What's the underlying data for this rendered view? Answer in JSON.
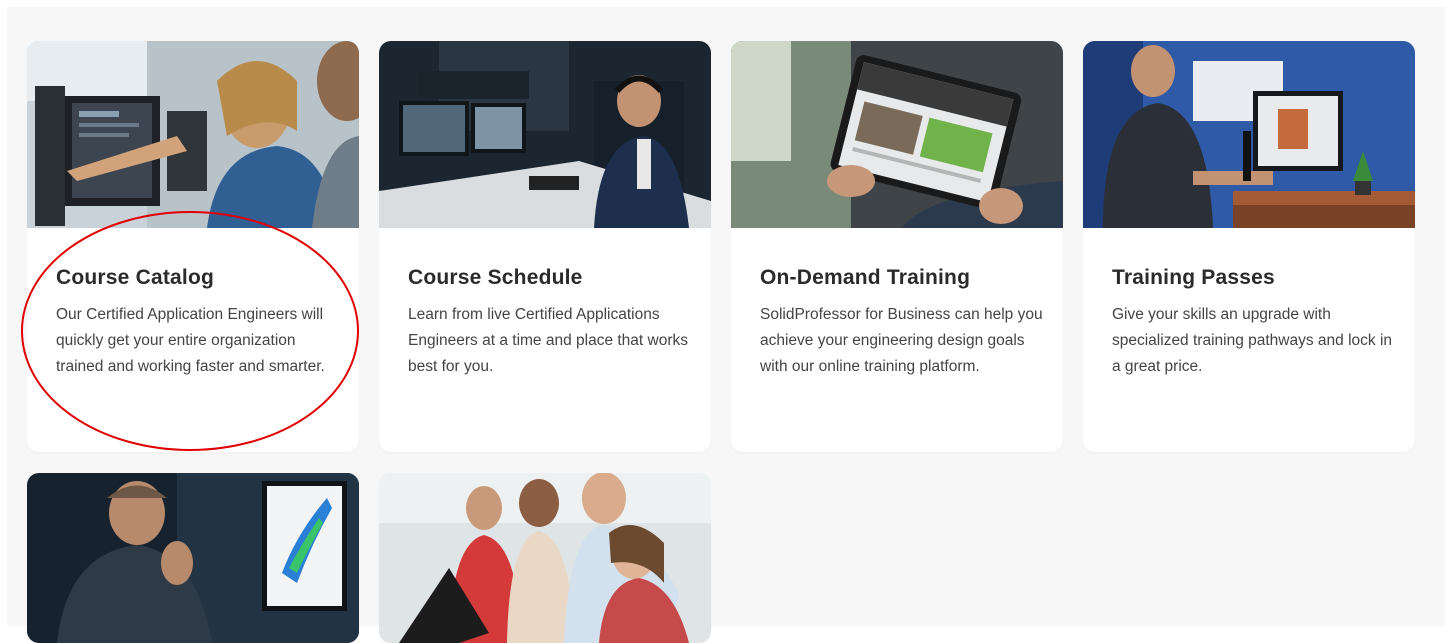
{
  "cards": [
    {
      "title": "Course Catalog",
      "description": "Our Certified Application Engineers will quickly get your entire organization trained and working faster and smarter."
    },
    {
      "title": "Course Schedule",
      "description": "Learn from live Certified Applications Engineers at a time and place that works best for you."
    },
    {
      "title": "On-Demand Training",
      "description": "SolidProfessor for Business can help you achieve your engineering design goals with our online training platform."
    },
    {
      "title": "Training Passes",
      "description": "Give your skills an upgrade with specialized training pathways and lock in a great price."
    }
  ],
  "annotation": {
    "color": "#e00000",
    "shape": "ellipse"
  }
}
